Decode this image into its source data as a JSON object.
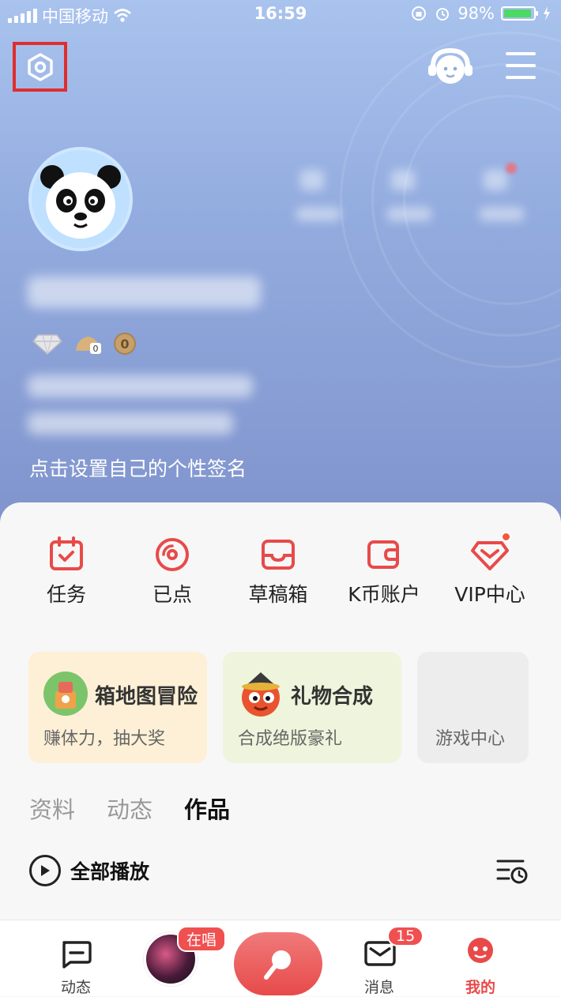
{
  "status_bar": {
    "carrier": "中国移动",
    "time": "16:59",
    "battery_percent": "98%",
    "battery_level": 0.98
  },
  "header": {
    "settings_icon": "settings-hexagon-icon",
    "kefu_icon": "customer-service-avatar-icon",
    "menu_icon": "hamburger-menu-icon"
  },
  "profile": {
    "coin_count": "0",
    "signature_placeholder": "点击设置自己的个性签名"
  },
  "quick_actions": [
    {
      "label": "任务",
      "icon": "task-calendar-icon"
    },
    {
      "label": "已点",
      "icon": "disc-icon"
    },
    {
      "label": "草稿箱",
      "icon": "draft-box-icon"
    },
    {
      "label": "K币账户",
      "icon": "wallet-icon"
    },
    {
      "label": "VIP中心",
      "icon": "vip-diamond-icon"
    }
  ],
  "promos": [
    {
      "title": "箱地图冒险",
      "subtitle": "赚体力，抽大奖"
    },
    {
      "title": "礼物合成",
      "subtitle": "合成绝版豪礼"
    },
    {
      "title": "",
      "subtitle": "游戏中心"
    }
  ],
  "tabs": [
    {
      "label": "资料"
    },
    {
      "label": "动态"
    },
    {
      "label": "作品"
    }
  ],
  "works": {
    "play_all_label": "全部播放"
  },
  "bottom_nav": {
    "feed_label": "动态",
    "live_tag": "在唱",
    "messages_label": "消息",
    "messages_badge": "15",
    "mine_label": "我的"
  },
  "colors": {
    "accent": "#e84a4a",
    "header_gradient_top": "#a9c3ee",
    "header_gradient_bottom": "#7f93cc",
    "settings_highlight": "#e02d2d",
    "battery": "#4cd964"
  }
}
